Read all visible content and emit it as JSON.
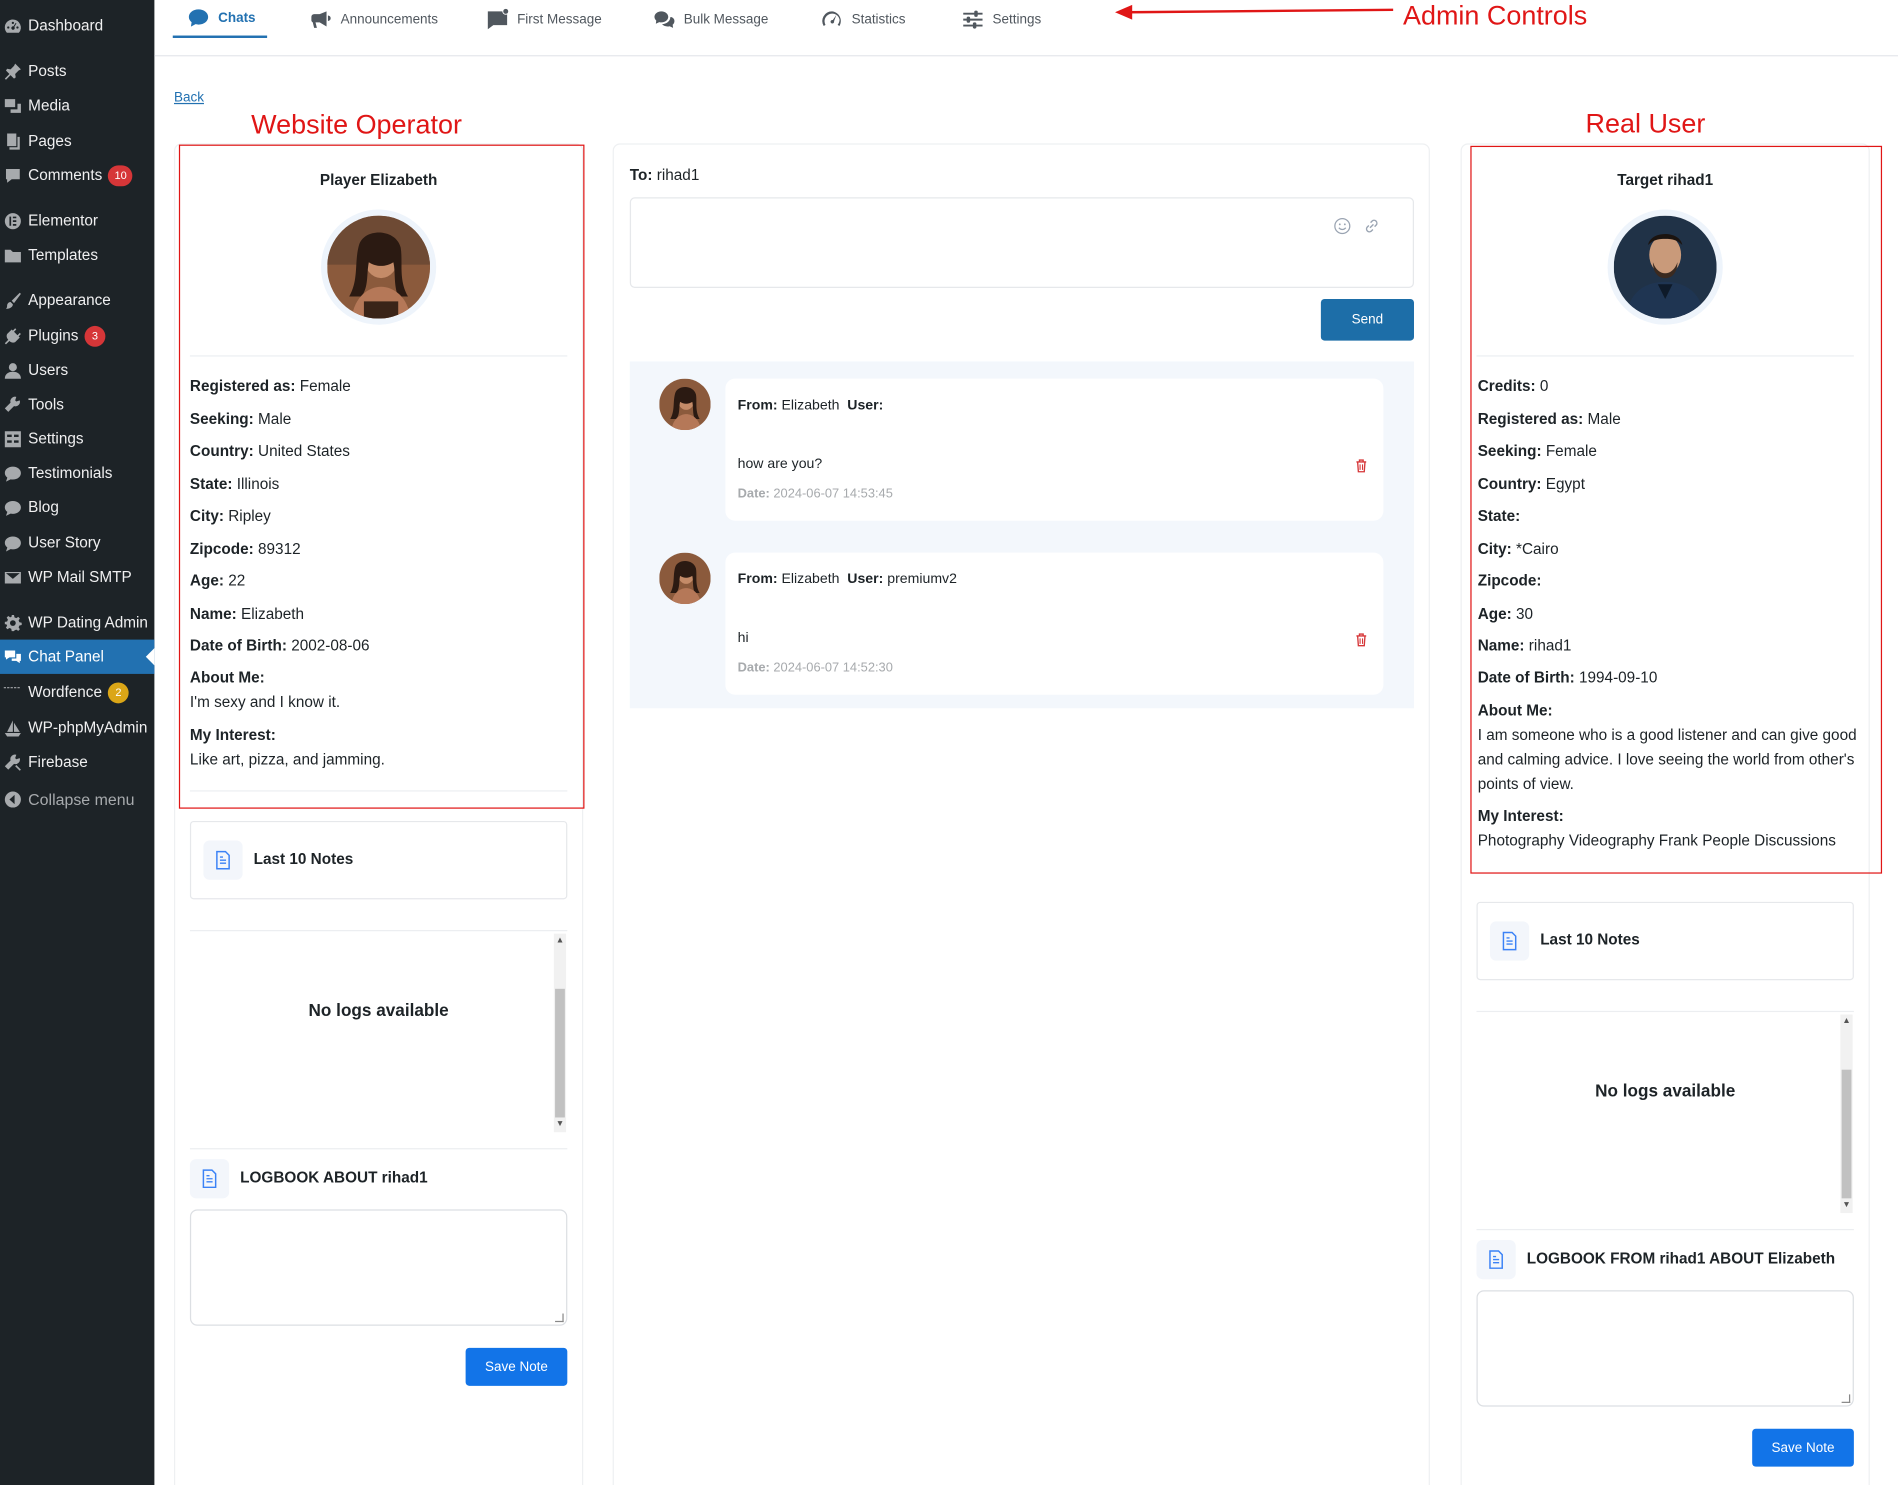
{
  "admin_menu": {
    "items": [
      {
        "label": "Dashboard",
        "icon": "dashboard-icon"
      },
      {
        "label": "Posts",
        "icon": "pin-icon"
      },
      {
        "label": "Media",
        "icon": "media-icon"
      },
      {
        "label": "Pages",
        "icon": "pages-icon"
      },
      {
        "label": "Comments",
        "icon": "comment-icon",
        "badge": "10"
      },
      {
        "label": "Elementor",
        "icon": "elementor-icon"
      },
      {
        "label": "Templates",
        "icon": "folder-icon"
      },
      {
        "label": "Appearance",
        "icon": "brush-icon"
      },
      {
        "label": "Plugins",
        "icon": "plug-icon",
        "badge": "3"
      },
      {
        "label": "Users",
        "icon": "user-icon"
      },
      {
        "label": "Tools",
        "icon": "wrench-icon"
      },
      {
        "label": "Settings",
        "icon": "settings-grid-icon"
      },
      {
        "label": "Testimonials",
        "icon": "speech-bubble-icon"
      },
      {
        "label": "Blog",
        "icon": "speech-bubble-icon"
      },
      {
        "label": "User Story",
        "icon": "speech-bubble-icon"
      },
      {
        "label": "WP Mail SMTP",
        "icon": "mail-icon"
      },
      {
        "label": "WP Dating Admin",
        "icon": "gear-icon"
      },
      {
        "label": "Chat Panel",
        "icon": "chat-icon"
      },
      {
        "label": "Wordfence",
        "icon": "wordfence-icon",
        "badge": "2"
      },
      {
        "label": "WP-phpMyAdmin",
        "icon": "sailboat-icon"
      },
      {
        "label": "Firebase",
        "icon": "tools-icon"
      }
    ],
    "collapse_label": "Collapse menu"
  },
  "tabs": [
    {
      "label": "Chats",
      "icon": "chat-bubble-icon",
      "active": true
    },
    {
      "label": "Announcements",
      "icon": "megaphone-icon"
    },
    {
      "label": "First Message",
      "icon": "message-icon"
    },
    {
      "label": "Bulk Message",
      "icon": "comments-icon"
    },
    {
      "label": "Statistics",
      "icon": "gauge-icon"
    },
    {
      "label": "Settings",
      "icon": "sliders-icon"
    }
  ],
  "annotations": {
    "admin_controls": "Admin Controls",
    "website_operator": "Website Operator",
    "real_user": "Real User",
    "color": "#e01616"
  },
  "back_link": "Back",
  "operator": {
    "title": "Player Elizabeth",
    "fields": [
      {
        "label": "Registered as:",
        "value": "Female"
      },
      {
        "label": "Seeking:",
        "value": "Male"
      },
      {
        "label": "Country:",
        "value": "United States"
      },
      {
        "label": "State:",
        "value": "Illinois"
      },
      {
        "label": "City:",
        "value": "Ripley"
      },
      {
        "label": "Zipcode:",
        "value": "89312"
      },
      {
        "label": "Age:",
        "value": "22"
      },
      {
        "label": "Name:",
        "value": "Elizabeth"
      },
      {
        "label": "Date of Birth:",
        "value": "2002-08-06"
      }
    ],
    "about_label": "About Me:",
    "about_text": "I'm sexy and I know it.",
    "interest_label": "My Interest:",
    "interest_text": "Like art, pizza, and jamming.",
    "notes_title": "Last 10 Notes",
    "no_logs": "No logs available",
    "logbook_title": "LOGBOOK ABOUT rihad1",
    "save_label": "Save Note"
  },
  "chat": {
    "to_label": "To:",
    "to_value": "rihad1",
    "send_label": "Send",
    "messages": [
      {
        "from_label": "From:",
        "from": "Elizabeth",
        "user_label": "User:",
        "user": "",
        "text": "how are you?",
        "date_label": "Date:",
        "date": "2024-06-07 14:53:45"
      },
      {
        "from_label": "From:",
        "from": "Elizabeth",
        "user_label": "User:",
        "user": "premiumv2",
        "text": "hi",
        "date_label": "Date:",
        "date": "2024-06-07 14:52:30"
      }
    ]
  },
  "target": {
    "title": "Target rihad1",
    "fields": [
      {
        "label": "Credits:",
        "value": "0"
      },
      {
        "label": "Registered as:",
        "value": "Male"
      },
      {
        "label": "Seeking:",
        "value": "Female"
      },
      {
        "label": "Country:",
        "value": "Egypt"
      },
      {
        "label": "State:",
        "value": ""
      },
      {
        "label": "City:",
        "value": "*Cairo"
      },
      {
        "label": "Zipcode:",
        "value": ""
      },
      {
        "label": "Age:",
        "value": "30"
      },
      {
        "label": "Name:",
        "value": "rihad1"
      },
      {
        "label": "Date of Birth:",
        "value": "1994-09-10"
      }
    ],
    "about_label": "About Me:",
    "about_text": "I am someone who is a good listener and can give good and calming advice. I love seeing the world from other's points of view.",
    "interest_label": "My Interest:",
    "interest_text": "Photography Videography Frank People Discussions",
    "notes_title": "Last 10 Notes",
    "no_logs": "No logs available",
    "logbook_title": "LOGBOOK FROM rihad1 ABOUT Elizabeth",
    "save_label": "Save Note"
  },
  "colors": {
    "sidebar": "#1d2327",
    "accent": "#2271b1",
    "button": "#1274e8",
    "send": "#1d6ea8",
    "delete": "#d63638"
  }
}
